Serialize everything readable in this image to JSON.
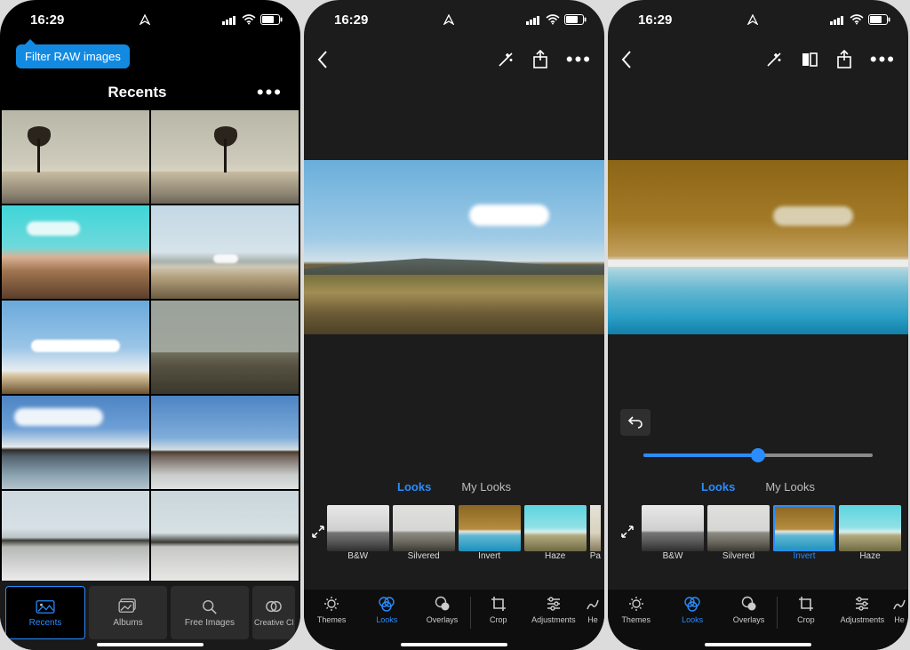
{
  "status": {
    "time": "16:29"
  },
  "panel1": {
    "tooltip": "Filter RAW images",
    "title": "Recents",
    "tabs": [
      {
        "label": "Recents"
      },
      {
        "label": "Albums"
      },
      {
        "label": "Free Images"
      },
      {
        "label": "Creative Cloud"
      }
    ]
  },
  "looks_tabs": {
    "looks": "Looks",
    "my_looks": "My Looks"
  },
  "looks": [
    {
      "label": "B&W"
    },
    {
      "label": "Silvered"
    },
    {
      "label": "Invert"
    },
    {
      "label": "Haze"
    },
    {
      "label": "Pa"
    }
  ],
  "panel3_looks": [
    {
      "label": "B&W"
    },
    {
      "label": "Silvered"
    },
    {
      "label": "Invert"
    },
    {
      "label": "Haze"
    }
  ],
  "slider": {
    "value": 50
  },
  "toolbar": {
    "themes": "Themes",
    "looks": "Looks",
    "overlays": "Overlays",
    "crop": "Crop",
    "adjustments": "Adjustments",
    "he": "He"
  }
}
